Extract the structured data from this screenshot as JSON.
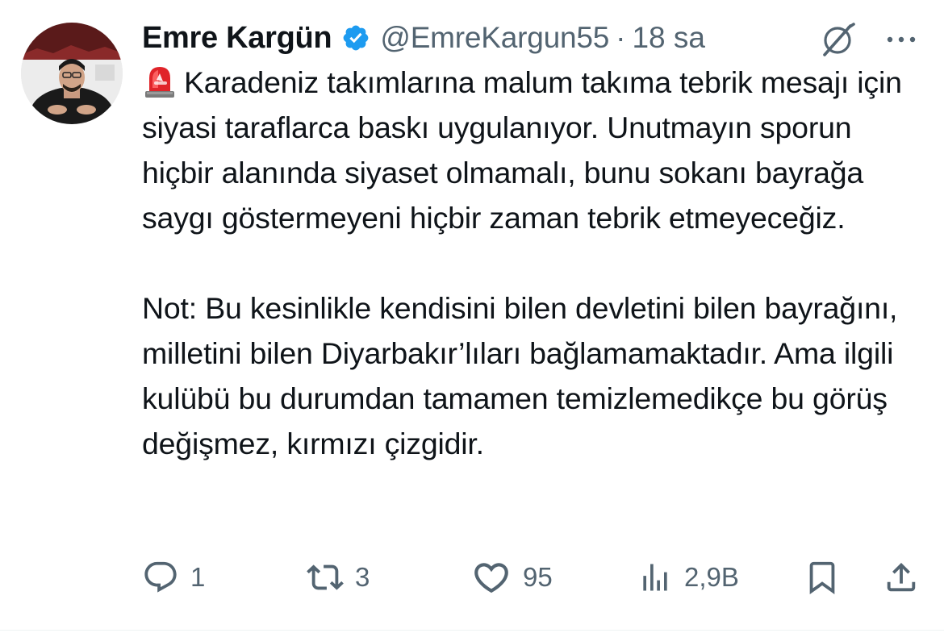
{
  "author": {
    "name": "Emre Kargün",
    "handle": "@EmreKargun55",
    "separator": "·",
    "time": "18 sa",
    "verified": true,
    "avatar_icon": "profile-photo"
  },
  "header_icons": {
    "grok": "grok-icon",
    "more": "more-options-icon"
  },
  "tweet": {
    "emoji": "siren-emoji",
    "paragraph1": "Karadeniz takımlarına malum takıma tebrik mesajı için siyasi taraflarca baskı uygulanıyor. Unutmayın sporun hiçbir alanında siyaset olmamalı, bunu sokanı bayrağa saygı göstermeyeni hiçbir zaman tebrik etmeyeceğiz.",
    "paragraph2": "Not: Bu kesinlikle kendisini bilen devletini bilen bayrağını, milletini bilen Diyarbakır’lıları bağlamamaktadır. Ama ilgili kulübü bu durumdan tamamen temizlemedikçe bu görüş değişmez, kırmızı çizgidir."
  },
  "actions": {
    "reply": {
      "icon": "reply-icon",
      "count": "1"
    },
    "retweet": {
      "icon": "retweet-icon",
      "count": "3"
    },
    "like": {
      "icon": "heart-icon",
      "count": "95"
    },
    "views": {
      "icon": "views-icon",
      "count": "2,9B"
    },
    "bookmark": {
      "icon": "bookmark-icon"
    },
    "share": {
      "icon": "share-icon"
    }
  },
  "colors": {
    "text": "#0f1419",
    "secondary": "#536471",
    "verified": "#1d9bf0",
    "divider": "#eff3f4"
  }
}
